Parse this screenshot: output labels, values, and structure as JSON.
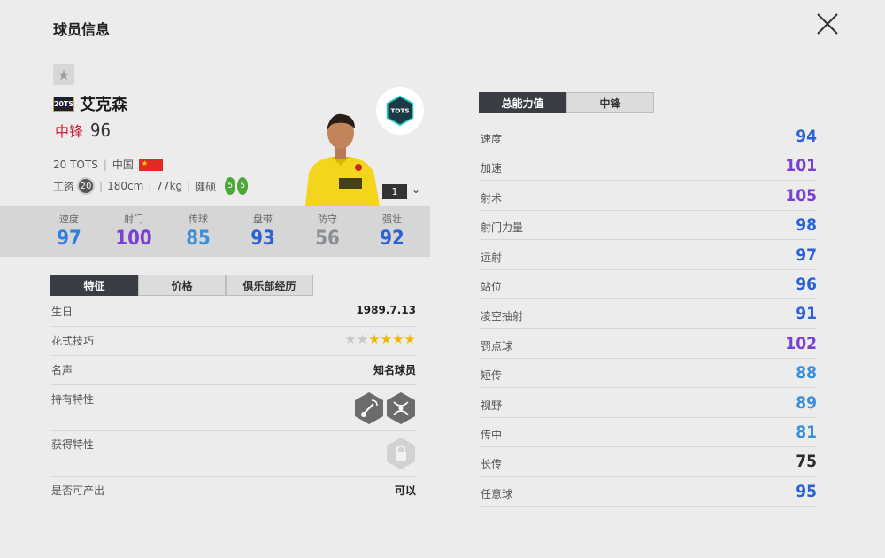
{
  "header": {
    "title": "球员信息"
  },
  "player": {
    "name": "艾克森",
    "season_badge": "20TS",
    "position": "中锋",
    "overall": "96",
    "season": "20 TOTS",
    "nation": "中国",
    "salary_label": "工资",
    "salary": "20",
    "height": "180cm",
    "weight": "77kg",
    "physique": "健硕",
    "left_foot": "5",
    "right_foot": "5",
    "card_badge": "TOTS",
    "level": "1"
  },
  "main_stats": [
    {
      "label": "速度",
      "value": "97",
      "color": "#2d7fe0"
    },
    {
      "label": "射门",
      "value": "100",
      "color": "#7a3fd4"
    },
    {
      "label": "传球",
      "value": "85",
      "color": "#3a8fd6"
    },
    {
      "label": "盘带",
      "value": "93",
      "color": "#2a62d6"
    },
    {
      "label": "防守",
      "value": "56",
      "color": "#8a8f96"
    },
    {
      "label": "强壮",
      "value": "92",
      "color": "#2a62d6"
    }
  ],
  "left_tabs": [
    {
      "label": "特征",
      "active": true
    },
    {
      "label": "价格",
      "active": false
    },
    {
      "label": "俱乐部经历",
      "active": false
    }
  ],
  "traits": {
    "birthday_label": "生日",
    "birthday": "1989.7.13",
    "skill_label": "花式技巧",
    "skill_stars": 4,
    "skill_max": 6,
    "fame_label": "名声",
    "fame": "知名球员",
    "traits_label": "持有特性",
    "acquired_label": "获得特性",
    "tradable_label": "是否可产出",
    "tradable": "可以"
  },
  "right_tabs": [
    {
      "label": "总能力值",
      "active": true
    },
    {
      "label": "中锋",
      "active": false
    }
  ],
  "attributes": [
    {
      "label": "速度",
      "value": "94",
      "color": "#2a62d6"
    },
    {
      "label": "加速",
      "value": "101",
      "color": "#7a3fd4"
    },
    {
      "label": "射术",
      "value": "105",
      "color": "#7a3fd4"
    },
    {
      "label": "射门力量",
      "value": "98",
      "color": "#2a62d6"
    },
    {
      "label": "远射",
      "value": "97",
      "color": "#2a62d6"
    },
    {
      "label": "站位",
      "value": "96",
      "color": "#2a62d6"
    },
    {
      "label": "凌空抽射",
      "value": "91",
      "color": "#2a62d6"
    },
    {
      "label": "罚点球",
      "value": "102",
      "color": "#7a3fd4"
    },
    {
      "label": "短传",
      "value": "88",
      "color": "#3a8fd6"
    },
    {
      "label": "视野",
      "value": "89",
      "color": "#3a8fd6"
    },
    {
      "label": "传中",
      "value": "81",
      "color": "#3a8fd6"
    },
    {
      "label": "长传",
      "value": "75",
      "color": "#2b2b2b"
    },
    {
      "label": "任意球",
      "value": "95",
      "color": "#2a62d6"
    }
  ]
}
